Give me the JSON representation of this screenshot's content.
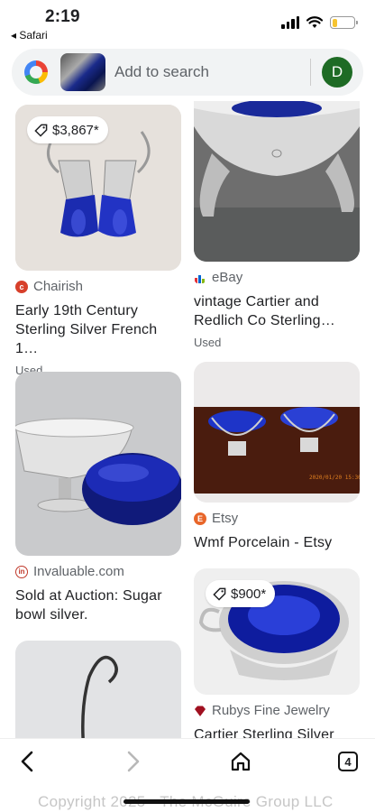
{
  "status": {
    "time": "2:19",
    "back_app": "◂ Safari",
    "battery_level": 0.25
  },
  "search": {
    "placeholder": "Add to search",
    "avatar_letter": "D"
  },
  "results": [
    {
      "price": "$3,867*",
      "source": "Chairish",
      "title": "Early 19th Century Sterling Silver French 1…",
      "condition": "Used",
      "source_color": "#d7402b"
    },
    {
      "source": "eBay",
      "title": "vintage Cartier and Redlich Co Sterling Silv…",
      "condition": "Used"
    },
    {
      "source": "Invaluable.com",
      "title": "Sold at Auction: Sugar bowl silver.",
      "source_color": "#c0392b"
    },
    {
      "source": "Etsy",
      "title": "Wmf Porcelain - Etsy",
      "source_color": "#e8662a"
    },
    {
      "price": "$900*",
      "source": "Rubys Fine Jewelry",
      "title": "Cartier Sterling Silver",
      "source_color": "#a01020"
    },
    {}
  ],
  "toolbar": {
    "tab_count": "4"
  },
  "watermark": "Copyright 2025 - The McGuire Group LLC"
}
